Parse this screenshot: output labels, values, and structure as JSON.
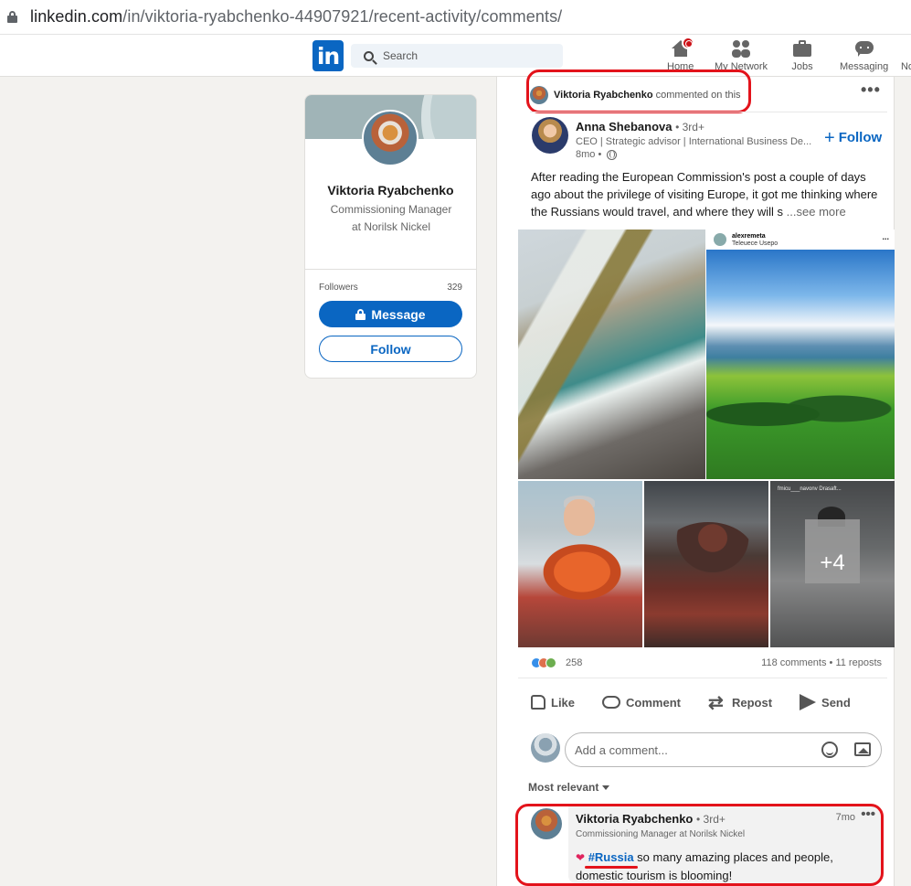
{
  "browser": {
    "url_host": "linkedin.com",
    "url_path": "/in/viktoria-ryabchenko-44907921/recent-activity/comments/"
  },
  "nav": {
    "logo": "in",
    "search_placeholder": "Search",
    "items": [
      {
        "label": "Home"
      },
      {
        "label": "My Network"
      },
      {
        "label": "Jobs"
      },
      {
        "label": "Messaging"
      },
      {
        "label": "No"
      }
    ]
  },
  "profile": {
    "name": "Viktoria Ryabchenko",
    "headline": "Commissioning Manager at Norilsk Nickel",
    "followers_label": "Followers",
    "followers_count": "329",
    "message_label": "Message",
    "follow_label": "Follow"
  },
  "activity": {
    "actor": "Viktoria Ryabchenko",
    "action_text": "commented on this",
    "more": "•••"
  },
  "post": {
    "author_name": "Anna Shebanova",
    "author_degree": "• 3rd+",
    "author_headline": "CEO | Strategic advisor | International Business De...",
    "time": "8mo •",
    "follow_label": "Follow",
    "follow_plus": "+",
    "text": "After reading the European Commission's post a couple of days ago about the privilege of visiting Europe, it got me thinking where the Russians would travel, and where they will s",
    "see_more": "...see more",
    "embed_user": "alexremeta",
    "embed_sub": "Teleuece Usepo",
    "embed_more": "...",
    "img5_tag": "fmicu___navonv Drasaft...",
    "more_images": "+4",
    "reactions_count": "258",
    "comments_reposts": "118 comments • 11 reposts",
    "actions": [
      {
        "label": "Like"
      },
      {
        "label": "Comment"
      },
      {
        "label": "Repost"
      },
      {
        "label": "Send"
      }
    ],
    "comment_placeholder": "Add a comment...",
    "sort_label": "Most relevant"
  },
  "comment": {
    "name": "Viktoria Ryabchenko",
    "degree": "• 3rd+",
    "headline": "Commissioning Manager at Norilsk Nickel",
    "time": "7mo",
    "more": "•••",
    "heart": "❤",
    "hashtag": "#Russia",
    "text": " so many amazing places and people, domestic tourism is blooming!"
  }
}
